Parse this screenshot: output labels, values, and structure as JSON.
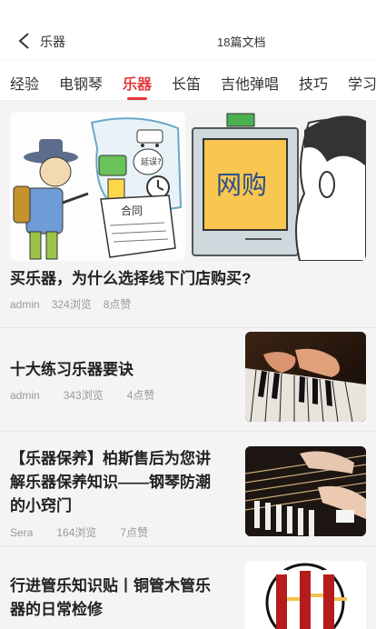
{
  "header": {
    "category_title": "乐器",
    "doc_count": "18篇文档"
  },
  "tabs": [
    {
      "label": "经验"
    },
    {
      "label": "电钢琴"
    },
    {
      "label": "乐器"
    },
    {
      "label": "长笛"
    },
    {
      "label": "吉他弹唱"
    },
    {
      "label": "技巧"
    },
    {
      "label": "学习"
    }
  ],
  "articles": [
    {
      "title": "买乐器，为什么选择线下门店购买?",
      "author": "admin",
      "views": "324浏览",
      "likes": "8点赞",
      "image_text": "网购",
      "image_text_2": "合同",
      "image_text_3": "延误?"
    },
    {
      "title": "十大练习乐器要诀",
      "author": "admin",
      "views": "343浏览",
      "likes": "4点赞"
    },
    {
      "title_line1": "【乐器保养】柏斯售后为您讲",
      "title_line2": "解乐器保养知识——钢琴防潮",
      "title_line3": "的小窍门",
      "author": "Sera",
      "views": "164浏览",
      "likes": "7点赞"
    },
    {
      "title_line1": "行进管乐知识贴丨铜管木管乐",
      "title_line2": "器的日常检修"
    }
  ],
  "colors": {
    "accent": "#e4393c",
    "meta": "#999999",
    "background": "#f4f4f4"
  }
}
